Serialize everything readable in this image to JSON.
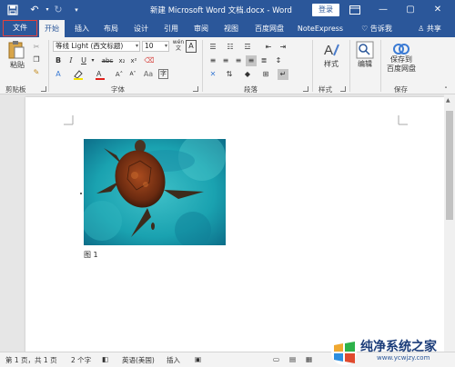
{
  "titlebar": {
    "doc_title": "新建 Microsoft Word 文档.docx  -  Word",
    "login_label": "登录",
    "min_glyph": "—",
    "restore_glyph": "▢",
    "close_glyph": "✕"
  },
  "tabs": [
    {
      "label": "文件"
    },
    {
      "label": "开始"
    },
    {
      "label": "插入"
    },
    {
      "label": "布局"
    },
    {
      "label": "设计"
    },
    {
      "label": "引用"
    },
    {
      "label": "审阅"
    },
    {
      "label": "视图"
    },
    {
      "label": "百度网盘"
    },
    {
      "label": "NoteExpress"
    },
    {
      "label": "告诉我"
    },
    {
      "label": "共享"
    }
  ],
  "ribbon": {
    "clipboard": {
      "paste_label": "粘贴",
      "group_label": "剪贴板"
    },
    "font": {
      "font_name": "等线 Light (西文标题)",
      "font_size": "10",
      "wen_label": "wén",
      "wen_sub": "文",
      "a_label": "A",
      "bold": "B",
      "italic": "I",
      "underline": "U",
      "strike": "abc",
      "sub": "x₂",
      "sup": "x²",
      "group_label": "字体"
    },
    "paragraph": {
      "group_label": "段落"
    },
    "styles": {
      "styles_label": "样式",
      "group_label": "样式"
    },
    "editing": {
      "edit_label": "编辑"
    },
    "save": {
      "save_label_1": "保存到",
      "save_label_2": "百度网盘",
      "group_label": "保存"
    }
  },
  "document": {
    "caption": "图 1"
  },
  "statusbar": {
    "page": "第 1 页，共 1 页",
    "words": "2 个字",
    "language": "英语(美国)",
    "mode": "插入"
  },
  "watermark": {
    "title": "纯净系统之家",
    "url": "www.ycwjzy.com"
  },
  "colors": {
    "brand": "#2b579a",
    "file_outline": "#e6413a"
  }
}
